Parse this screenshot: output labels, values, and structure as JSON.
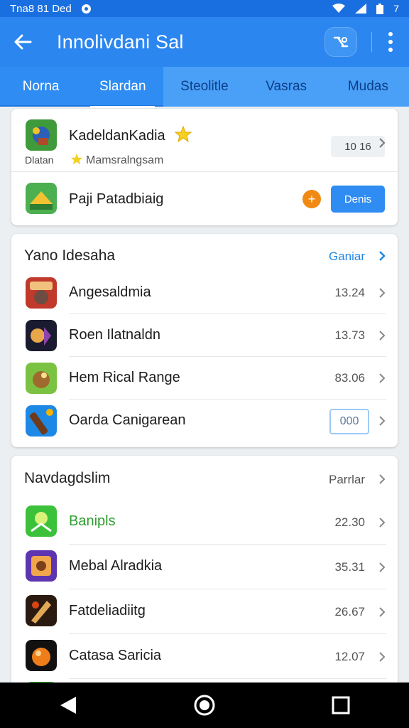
{
  "status_bar": {
    "time": "Tna8 81 Ded",
    "right_text": "7"
  },
  "app_bar": {
    "title": "Innolivdani Sal"
  },
  "tabs": [
    {
      "label": "Norna"
    },
    {
      "label": "Slardan"
    },
    {
      "label": "Steolitle"
    },
    {
      "label": "Vasras"
    },
    {
      "label": "Mudas"
    }
  ],
  "featured": {
    "item1": {
      "title": "KadeldanKadia",
      "caption": "Dlatan",
      "subtitle": "Mamsralngsam",
      "value": "10 16"
    },
    "item2": {
      "title": "Paji Patadbiaig",
      "plus": "+",
      "button": "Denis"
    }
  },
  "section1": {
    "title": "Yano Idesaha",
    "link": "Ganiar",
    "items": [
      {
        "title": "Angesaldmia",
        "value": "13.24"
      },
      {
        "title": "Roen Ilatnaldn",
        "value": "13.73"
      },
      {
        "title": "Hem Rical Range",
        "value": "83.06"
      },
      {
        "title": "Oarda Canigarean",
        "badge": "000"
      }
    ]
  },
  "section2": {
    "title": "Navdagdslim",
    "link": "Parrlar",
    "items": [
      {
        "title": "Banipls",
        "value": "22.30"
      },
      {
        "title": "Mebal Alradkia",
        "value": "35.31"
      },
      {
        "title": "Fatdeliadiitg",
        "value": "26.67"
      },
      {
        "title": "Catasa Saricia",
        "value": "12.07"
      }
    ]
  },
  "colors": {
    "primary": "#2b86f0",
    "status_bar": "#1a6fe0",
    "accent_orange": "#f08a14",
    "link_blue": "#1e88e5",
    "green_text": "#2e9e2e"
  }
}
